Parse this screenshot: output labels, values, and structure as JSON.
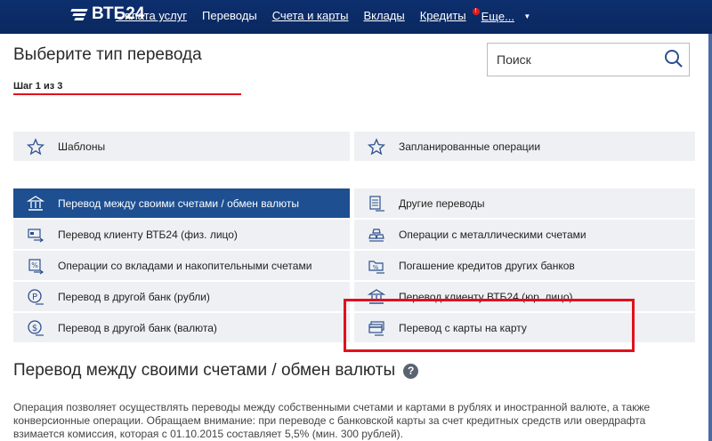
{
  "brand": {
    "logo_text": "ВТБ24"
  },
  "nav": {
    "items": [
      {
        "label": "Оплата услуг",
        "active": false
      },
      {
        "label": "Переводы",
        "active": true
      },
      {
        "label": "Счета и карты",
        "active": false
      },
      {
        "label": "Вклады",
        "active": false
      },
      {
        "label": "Кредиты",
        "active": false
      }
    ],
    "more_label": "Еще...",
    "more_badge": "!"
  },
  "page": {
    "title": "Выберите тип перевода",
    "step": "Шаг 1 из 3"
  },
  "search": {
    "placeholder": "Поиск"
  },
  "quick": [
    {
      "label": "Шаблоны",
      "icon": "star-icon"
    },
    {
      "label": "Запланированные операции",
      "icon": "star-icon"
    }
  ],
  "left_options": [
    {
      "label": "Перевод между своими счетами / обмен валюты",
      "icon": "bank-building-icon",
      "active": true
    },
    {
      "label": "Перевод клиенту ВТБ24 (физ. лицо)",
      "icon": "card-transfer-icon",
      "active": false
    },
    {
      "label": "Операции со вкладами и накопительными счетами",
      "icon": "deposit-icon",
      "active": false
    },
    {
      "label": "Перевод в другой банк (рубли)",
      "icon": "ruble-coin-icon",
      "active": false
    },
    {
      "label": "Перевод в другой банк (валюта)",
      "icon": "dollar-coin-icon",
      "active": false
    }
  ],
  "right_options": [
    {
      "label": "Другие переводы",
      "icon": "document-icon"
    },
    {
      "label": "Операции с металлическими счетами",
      "icon": "gold-bars-icon"
    },
    {
      "label": "Погашение кредитов других банков",
      "icon": "folder-transfer-icon"
    },
    {
      "label": "Перевод клиенту ВТБ24 (юр. лицо)",
      "icon": "bank-building-icon"
    },
    {
      "label": "Перевод с карты на карту",
      "icon": "cards-icon"
    }
  ],
  "section": {
    "title": "Перевод между своими счетами / обмен валюты",
    "help": "?",
    "description": "Операция позволяет осуществлять переводы между собственными счетами и картами в рублях и иностранной валюте, а также конверсионные операции. Обращаем внимание: при переводе с банковской карты за счет кредитных средств или овердрафта взимается комиссия, которая с 01.10.2015 составляет 5,5% (мин. 300 рублей)."
  },
  "colors": {
    "nav_bg": "#0a2860",
    "active_tile": "#1d4f91",
    "accent_red": "#e2101c",
    "tile_bg": "#eef0f3"
  }
}
